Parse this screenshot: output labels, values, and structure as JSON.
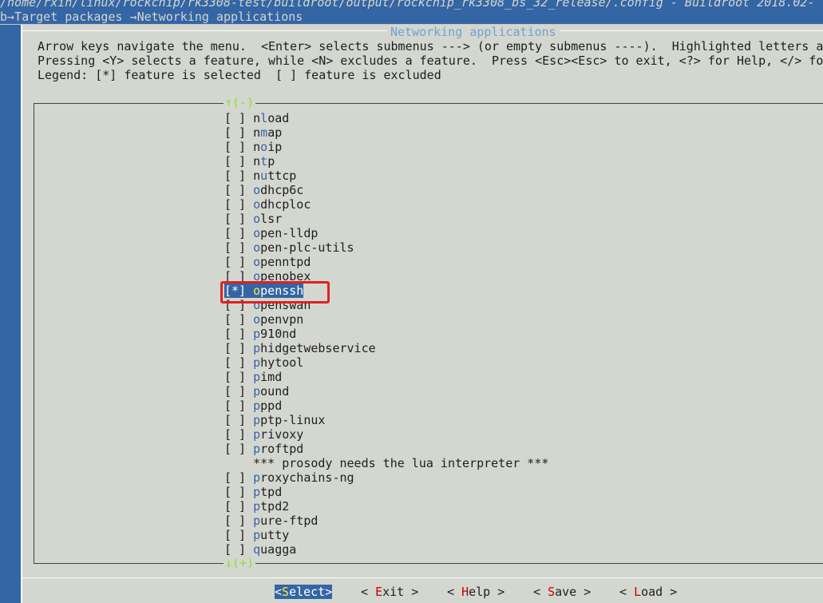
{
  "window": {
    "title_line": "/home/rxin/linux/rockchip/rk3308-test/buildroot/output/rockchip_rk3308_bs_32_release/.config - Buildroot 2018.02-",
    "breadcrumb": "b→Target packages →Networking applications"
  },
  "dialog": {
    "title": "Networking applications",
    "help_lines": [
      "Arrow keys navigate the menu.  <Enter> selects submenus ---> (or empty submenus ----).  Highlighted letters ar",
      "Pressing <Y> selects a feature, while <N> excludes a feature.  Press <Esc><Esc> to exit, <?> for Help, </> for",
      "Legend: [*] feature is selected  [ ] feature is excluded"
    ],
    "scroll_up": "↑(-)",
    "scroll_down": "↓(+)"
  },
  "items": [
    {
      "box": "[ ]",
      "first": "n",
      "hot": "l",
      "rest": "oad"
    },
    {
      "box": "[ ]",
      "first": "n",
      "hot": "m",
      "rest": "ap"
    },
    {
      "box": "[ ]",
      "first": "n",
      "hot": "o",
      "rest": "ip"
    },
    {
      "box": "[ ]",
      "first": "n",
      "hot": "t",
      "rest": "p"
    },
    {
      "box": "[ ]",
      "first": "n",
      "hot": "u",
      "rest": "ttcp"
    },
    {
      "box": "[ ]",
      "first": "",
      "hot": "o",
      "rest": "dhcp6c"
    },
    {
      "box": "[ ]",
      "first": "",
      "hot": "o",
      "rest": "dhcploc"
    },
    {
      "box": "[ ]",
      "first": "",
      "hot": "o",
      "rest": "lsr"
    },
    {
      "box": "[ ]",
      "first": "",
      "hot": "o",
      "rest": "pen-lldp"
    },
    {
      "box": "[ ]",
      "first": "",
      "hot": "o",
      "rest": "pen-plc-utils"
    },
    {
      "box": "[ ]",
      "first": "",
      "hot": "o",
      "rest": "penntpd"
    },
    {
      "box": "[ ]",
      "first": "",
      "hot": "o",
      "rest": "penobex"
    },
    {
      "box": "[*]",
      "first": "",
      "hot": "o",
      "rest": "penssh",
      "selected": true
    },
    {
      "box": "[ ]",
      "first": "",
      "hot": "o",
      "rest": "penswan"
    },
    {
      "box": "[ ]",
      "first": "",
      "hot": "o",
      "rest": "penvpn"
    },
    {
      "box": "[ ]",
      "first": "",
      "hot": "p",
      "rest": "910nd"
    },
    {
      "box": "[ ]",
      "first": "",
      "hot": "p",
      "rest": "hidgetwebservice"
    },
    {
      "box": "[ ]",
      "first": "",
      "hot": "p",
      "rest": "hytool"
    },
    {
      "box": "[ ]",
      "first": "",
      "hot": "p",
      "rest": "imd"
    },
    {
      "box": "[ ]",
      "first": "",
      "hot": "p",
      "rest": "ound"
    },
    {
      "box": "[ ]",
      "first": "",
      "hot": "p",
      "rest": "ppd"
    },
    {
      "box": "[ ]",
      "first": "",
      "hot": "p",
      "rest": "ptp-linux"
    },
    {
      "box": "[ ]",
      "first": "",
      "hot": "p",
      "rest": "rivoxy"
    },
    {
      "box": "[ ]",
      "first": "",
      "hot": "p",
      "rest": "roftpd"
    },
    {
      "comment": "    *** prosody needs the lua interpreter ***"
    },
    {
      "box": "[ ]",
      "first": "",
      "hot": "p",
      "rest": "roxychains-ng"
    },
    {
      "box": "[ ]",
      "first": "",
      "hot": "p",
      "rest": "tpd"
    },
    {
      "box": "[ ]",
      "first": "",
      "hot": "p",
      "rest": "tpd2"
    },
    {
      "box": "[ ]",
      "first": "",
      "hot": "p",
      "rest": "ure-ftpd"
    },
    {
      "box": "[ ]",
      "first": "",
      "hot": "p",
      "rest": "utty"
    },
    {
      "box": "[ ]",
      "first": "",
      "hot": "q",
      "rest": "uagga"
    }
  ],
  "buttons": [
    {
      "pre": "<",
      "hot": "S",
      "rest": "elect>",
      "active": true,
      "name": "select-button"
    },
    {
      "pre": "< ",
      "hot": "E",
      "rest": "xit >",
      "active": false,
      "name": "exit-button"
    },
    {
      "pre": "< ",
      "hot": "H",
      "rest": "elp >",
      "active": false,
      "name": "help-button"
    },
    {
      "pre": "< ",
      "hot": "S",
      "rest": "ave >",
      "active": false,
      "name": "save-button"
    },
    {
      "pre": "< ",
      "hot": "L",
      "rest": "oad >",
      "active": false,
      "name": "load-button"
    }
  ]
}
